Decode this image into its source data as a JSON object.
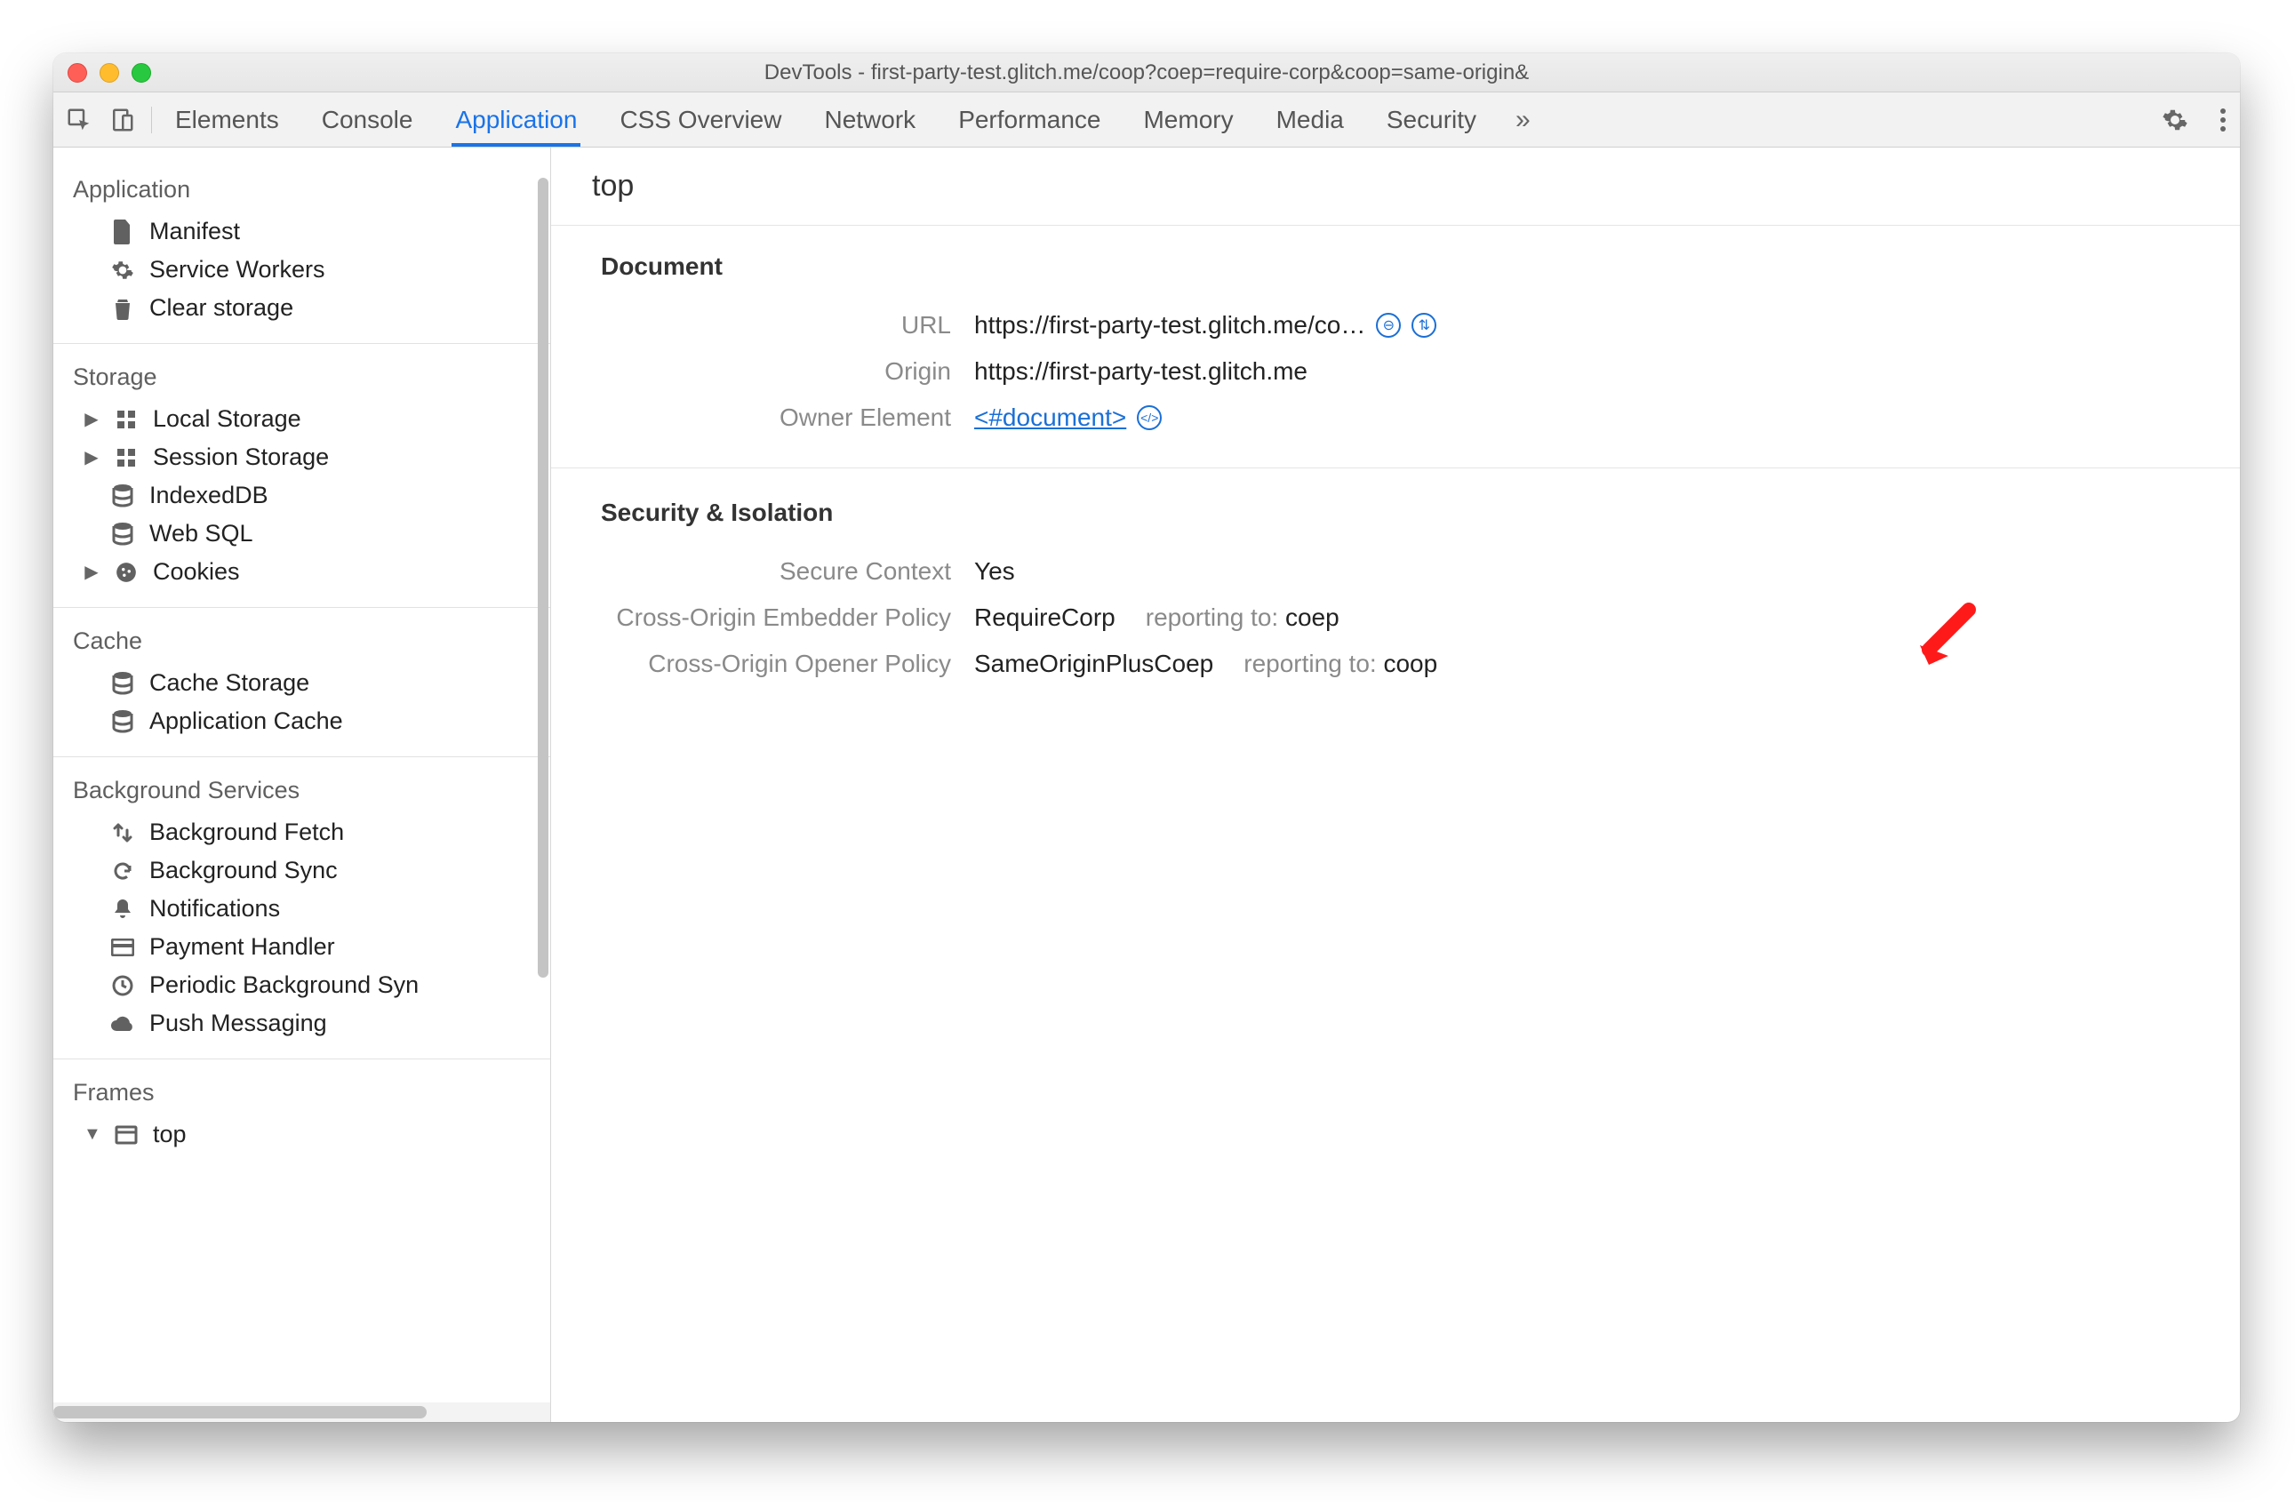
{
  "window": {
    "title": "DevTools - first-party-test.glitch.me/coop?coep=require-corp&coop=same-origin&"
  },
  "tabs": {
    "items": [
      "Elements",
      "Console",
      "Application",
      "CSS Overview",
      "Network",
      "Performance",
      "Memory",
      "Media",
      "Security"
    ],
    "active_index": 2
  },
  "sidebar": {
    "groups": [
      {
        "title": "Application",
        "items": [
          {
            "label": "Manifest",
            "icon": "file"
          },
          {
            "label": "Service Workers",
            "icon": "gear"
          },
          {
            "label": "Clear storage",
            "icon": "trash"
          }
        ]
      },
      {
        "title": "Storage",
        "items": [
          {
            "label": "Local Storage",
            "icon": "grid",
            "expandable": true
          },
          {
            "label": "Session Storage",
            "icon": "grid",
            "expandable": true
          },
          {
            "label": "IndexedDB",
            "icon": "db"
          },
          {
            "label": "Web SQL",
            "icon": "db"
          },
          {
            "label": "Cookies",
            "icon": "cookie",
            "expandable": true
          }
        ]
      },
      {
        "title": "Cache",
        "items": [
          {
            "label": "Cache Storage",
            "icon": "db"
          },
          {
            "label": "Application Cache",
            "icon": "db"
          }
        ]
      },
      {
        "title": "Background Services",
        "items": [
          {
            "label": "Background Fetch",
            "icon": "updown"
          },
          {
            "label": "Background Sync",
            "icon": "sync"
          },
          {
            "label": "Notifications",
            "icon": "bell"
          },
          {
            "label": "Payment Handler",
            "icon": "card"
          },
          {
            "label": "Periodic Background Syn",
            "icon": "clock"
          },
          {
            "label": "Push Messaging",
            "icon": "cloud"
          }
        ]
      },
      {
        "title": "Frames",
        "items": [
          {
            "label": "top",
            "icon": "window",
            "expandable": true,
            "expanded": true
          }
        ]
      }
    ]
  },
  "content": {
    "heading": "top",
    "document": {
      "title": "Document",
      "url_label": "URL",
      "url_value": "https://first-party-test.glitch.me/co…",
      "origin_label": "Origin",
      "origin_value": "https://first-party-test.glitch.me",
      "owner_label": "Owner Element",
      "owner_value": "<#document>"
    },
    "security": {
      "title": "Security & Isolation",
      "secure_label": "Secure Context",
      "secure_value": "Yes",
      "coep_label": "Cross-Origin Embedder Policy",
      "coep_value": "RequireCorp",
      "coep_report_label": "reporting to:",
      "coep_report_value": "coep",
      "coop_label": "Cross-Origin Opener Policy",
      "coop_value": "SameOriginPlusCoep",
      "coop_report_label": "reporting to:",
      "coop_report_value": "coop"
    }
  }
}
